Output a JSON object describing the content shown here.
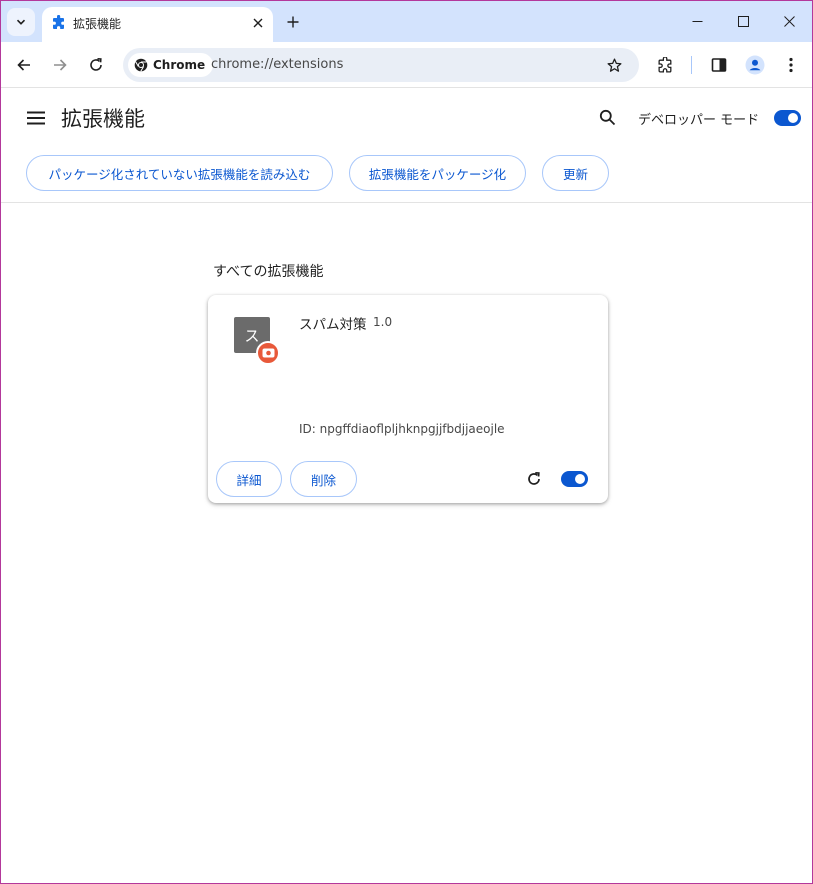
{
  "tab": {
    "title": "拡張機能",
    "favicon": "puzzle-icon"
  },
  "omnibox": {
    "chip_label": "Chrome",
    "url": "chrome://extensions"
  },
  "header": {
    "title": "拡張機能",
    "developer_mode_label": "デベロッパー モード",
    "developer_mode": true
  },
  "actions": {
    "load_unpacked": "パッケージ化されていない拡張機能を読み込む",
    "pack": "拡張機能をパッケージ化",
    "update": "更新"
  },
  "section": {
    "title": "すべての拡張機能"
  },
  "extension": {
    "icon_letter": "ス",
    "name": "スパム対策",
    "version": "1.0",
    "id": "ID: npgffdiaoflpljhknpgjjfbdjjaeojle",
    "details_label": "詳細",
    "remove_label": "削除",
    "enabled": true
  },
  "colors": {
    "accent": "#0b57d0",
    "tabstrip": "#d3e3fd",
    "omnibox": "#e9eef6",
    "badge": "#e8593a"
  }
}
